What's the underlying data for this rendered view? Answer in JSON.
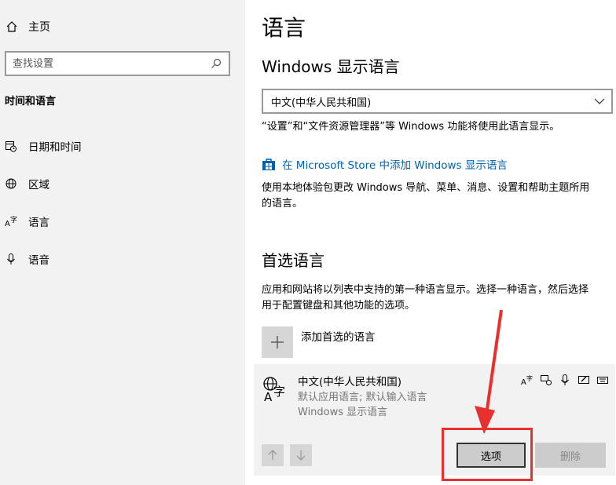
{
  "sidebar": {
    "home_label": "主页",
    "search_placeholder": "查找设置",
    "section_title": "时间和语言",
    "items": [
      {
        "label": "日期和时间",
        "icon": "calendar-clock-icon"
      },
      {
        "label": "区域",
        "icon": "globe-icon"
      },
      {
        "label": "语言",
        "icon": "language-icon"
      },
      {
        "label": "语音",
        "icon": "microphone-icon"
      }
    ]
  },
  "main": {
    "title": "语言",
    "display_language_heading": "Windows 显示语言",
    "display_language_selected": "中文(中华人民共和国)",
    "display_language_note": "“设置”和“文件资源管理器”等 Windows 功能将使用此语言显示。",
    "store_link": "在 Microsoft Store 中添加 Windows 显示语言",
    "local_experience_text_line1": "使用本地体验包更改 Windows 导航、菜单、消息、设置和帮助主题所用",
    "local_experience_text_line2": "的语言。",
    "preferred_heading": "首选语言",
    "preferred_desc_line1": "应用和网站将以列表中支持的第一种语言显示。选择一种语言，然后选择",
    "preferred_desc_line2": "用于配置键盘和其他功能的选项。",
    "add_language_label": "添加首选的语言",
    "language_entry": {
      "name": "中文(中华人民共和国)",
      "sub1": "默认应用语言; 默认输入语言",
      "sub2": "Windows 显示语言"
    },
    "options_button": "选项",
    "remove_button": "删除"
  },
  "colors": {
    "accent_link": "#0063b1",
    "annotation_red": "#e8312f",
    "sidebar_bg": "#f2f2f2"
  }
}
